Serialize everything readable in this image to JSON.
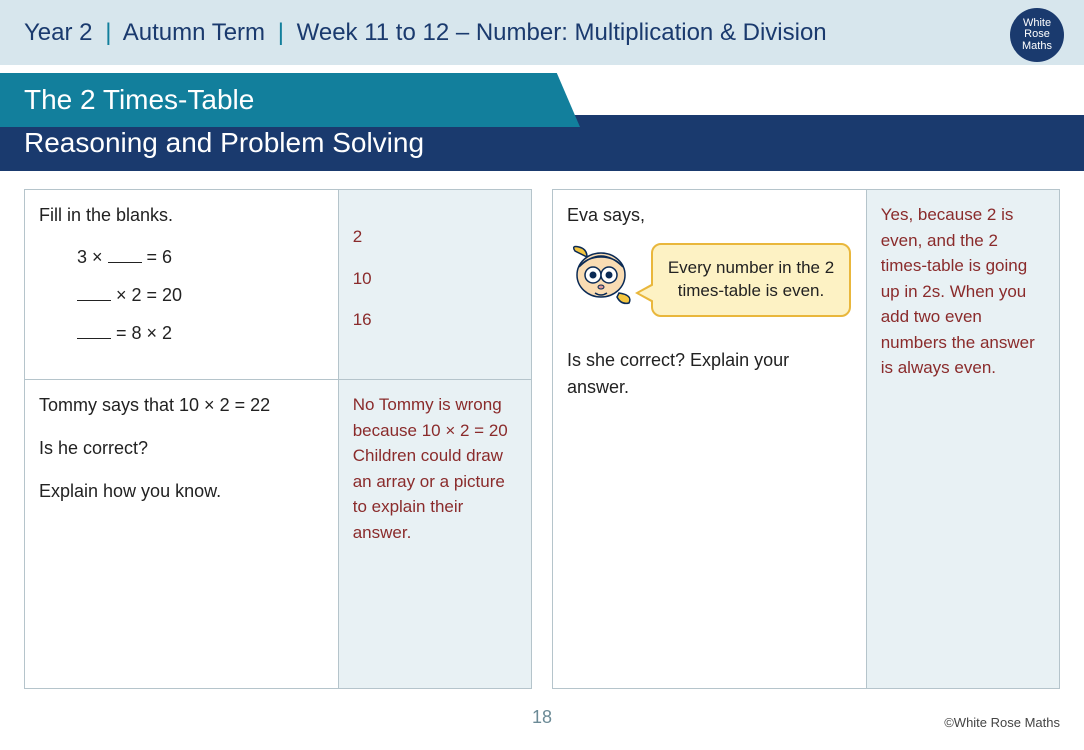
{
  "header": {
    "year": "Year 2",
    "term": "Autumn Term",
    "week": "Week 11 to 12 – Number: Multiplication & Division",
    "logo_line1": "White",
    "logo_line2": "Rose",
    "logo_line3": "Maths"
  },
  "title": "The 2 Times-Table",
  "subtitle": "Reasoning and Problem Solving",
  "left": {
    "top_q_intro": "Fill in the blanks.",
    "eq1_left": "3 × ",
    "eq1_right": " = 6",
    "eq2_mid": " × 2 = 20",
    "eq3_right": " = 8 × 2",
    "top_a1": "2",
    "top_a2": "10",
    "top_a3": "16",
    "bot_q_l1": "Tommy says that 10 × 2 = 22",
    "bot_q_l2": "Is he correct?",
    "bot_q_l3": "Explain how you know.",
    "bot_a": "No Tommy is wrong because 10 × 2 = 20\nChildren could draw an array or a picture to explain their answer."
  },
  "right": {
    "intro": "Eva says,",
    "bubble": "Every number in the 2 times-table is even.",
    "followup": "Is she correct? Explain your answer.",
    "answer": "Yes, because 2 is even, and the 2 times-table is going up in 2s. When you add two even numbers the answer is always even."
  },
  "page_number": "18",
  "copyright": "©White Rose Maths"
}
